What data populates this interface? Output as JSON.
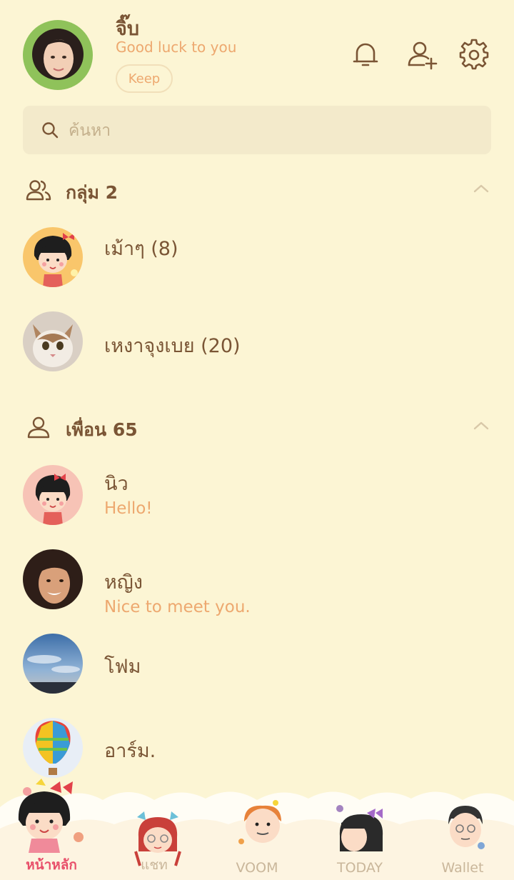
{
  "profile": {
    "name": "จิ๊บ",
    "status": "Good luck to you",
    "keep_label": "Keep"
  },
  "header_icons": [
    "bell-icon",
    "add-friend-icon",
    "settings-icon"
  ],
  "search": {
    "placeholder": "ค้นหา"
  },
  "groups": {
    "title": "กลุ่ม 2",
    "items": [
      {
        "name": "เม้าๆ (8)"
      },
      {
        "name": "เหงาจุงเบย (20)"
      }
    ]
  },
  "friends": {
    "title": "เพื่อน 65",
    "items": [
      {
        "name": "นิว",
        "status": "Hello!"
      },
      {
        "name": "หญิง",
        "status": "Nice to meet you."
      },
      {
        "name": "โฟม",
        "status": ""
      },
      {
        "name": "อาร์ม.",
        "status": ""
      }
    ]
  },
  "tabs": [
    {
      "label": "หน้าหลัก",
      "active": true
    },
    {
      "label": "แชท",
      "active": false
    },
    {
      "label": "VOOM",
      "active": false
    },
    {
      "label": "TODAY",
      "active": false
    },
    {
      "label": "Wallet",
      "active": false
    }
  ],
  "colors": {
    "background": "#fcf5d4",
    "text": "#7a5535",
    "accent": "#eda86f",
    "active_tab": "#e8506a"
  }
}
